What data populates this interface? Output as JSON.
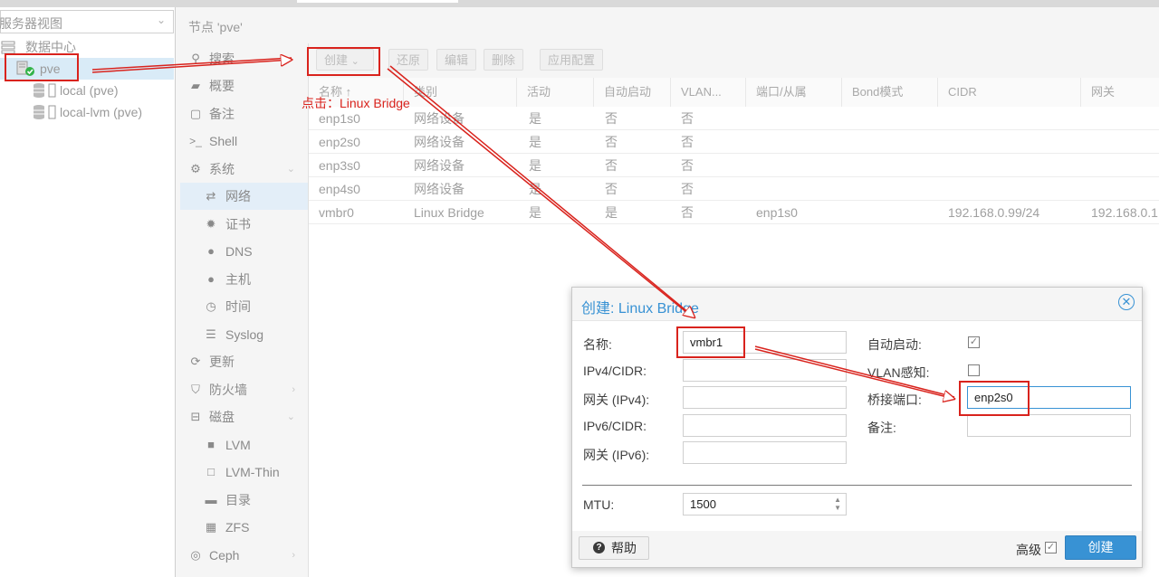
{
  "left_panel": {
    "view_selector": "服务器视图",
    "tree": [
      {
        "label": "数据中心"
      },
      {
        "label": "pve"
      },
      {
        "label": "local (pve)"
      },
      {
        "label": "local-lvm (pve)"
      }
    ]
  },
  "header": {
    "title": "节点 'pve'"
  },
  "nav": [
    {
      "label": "搜索"
    },
    {
      "label": "概要"
    },
    {
      "label": "备注"
    },
    {
      "label": "Shell"
    },
    {
      "label": "系统"
    },
    {
      "label": "网络"
    },
    {
      "label": "证书"
    },
    {
      "label": "DNS"
    },
    {
      "label": "主机"
    },
    {
      "label": "时间"
    },
    {
      "label": "Syslog"
    },
    {
      "label": "更新"
    },
    {
      "label": "防火墙"
    },
    {
      "label": "磁盘"
    },
    {
      "label": "LVM"
    },
    {
      "label": "LVM-Thin"
    },
    {
      "label": "目录"
    },
    {
      "label": "ZFS"
    },
    {
      "label": "Ceph"
    }
  ],
  "toolbar": {
    "create": "创建",
    "revert": "还原",
    "edit": "编辑",
    "delete": "删除",
    "apply": "应用配置"
  },
  "grid": {
    "columns": [
      "名称 ↑",
      "类别",
      "活动",
      "自动启动",
      "VLAN...",
      "端口/从属",
      "Bond模式",
      "CIDR",
      "网关"
    ],
    "rows": [
      [
        "enp1s0",
        "网络设备",
        "是",
        "否",
        "否",
        "",
        "",
        "",
        ""
      ],
      [
        "enp2s0",
        "网络设备",
        "是",
        "否",
        "否",
        "",
        "",
        "",
        ""
      ],
      [
        "enp3s0",
        "网络设备",
        "是",
        "否",
        "否",
        "",
        "",
        "",
        ""
      ],
      [
        "enp4s0",
        "网络设备",
        "是",
        "否",
        "否",
        "",
        "",
        "",
        ""
      ],
      [
        "vmbr0",
        "Linux Bridge",
        "是",
        "是",
        "否",
        "enp1s0",
        "",
        "192.168.0.99/24",
        "192.168.0.1"
      ]
    ]
  },
  "annotation": {
    "text": "点击：Linux Bridge"
  },
  "dialog": {
    "title": "创建: Linux Bridge",
    "fields": {
      "name_label": "名称:",
      "name_value": "vmbr1",
      "ipv4_label": "IPv4/CIDR:",
      "gw4_label": "网关 (IPv4):",
      "ipv6_label": "IPv6/CIDR:",
      "gw6_label": "网关 (IPv6):",
      "autostart_label": "自动启动:",
      "vlan_label": "VLAN感知:",
      "bridge_ports_label": "桥接端口:",
      "bridge_ports_value": "enp2s0",
      "comment_label": "备注:",
      "mtu_label": "MTU:",
      "mtu_value": "1500"
    },
    "autostart_checked": true,
    "vlan_checked": false,
    "advanced_label": "高级",
    "advanced_checked": true,
    "help_label": "帮助",
    "create_label": "创建"
  },
  "colors": {
    "accent": "#3892d4",
    "annotation": "#d9231d"
  }
}
